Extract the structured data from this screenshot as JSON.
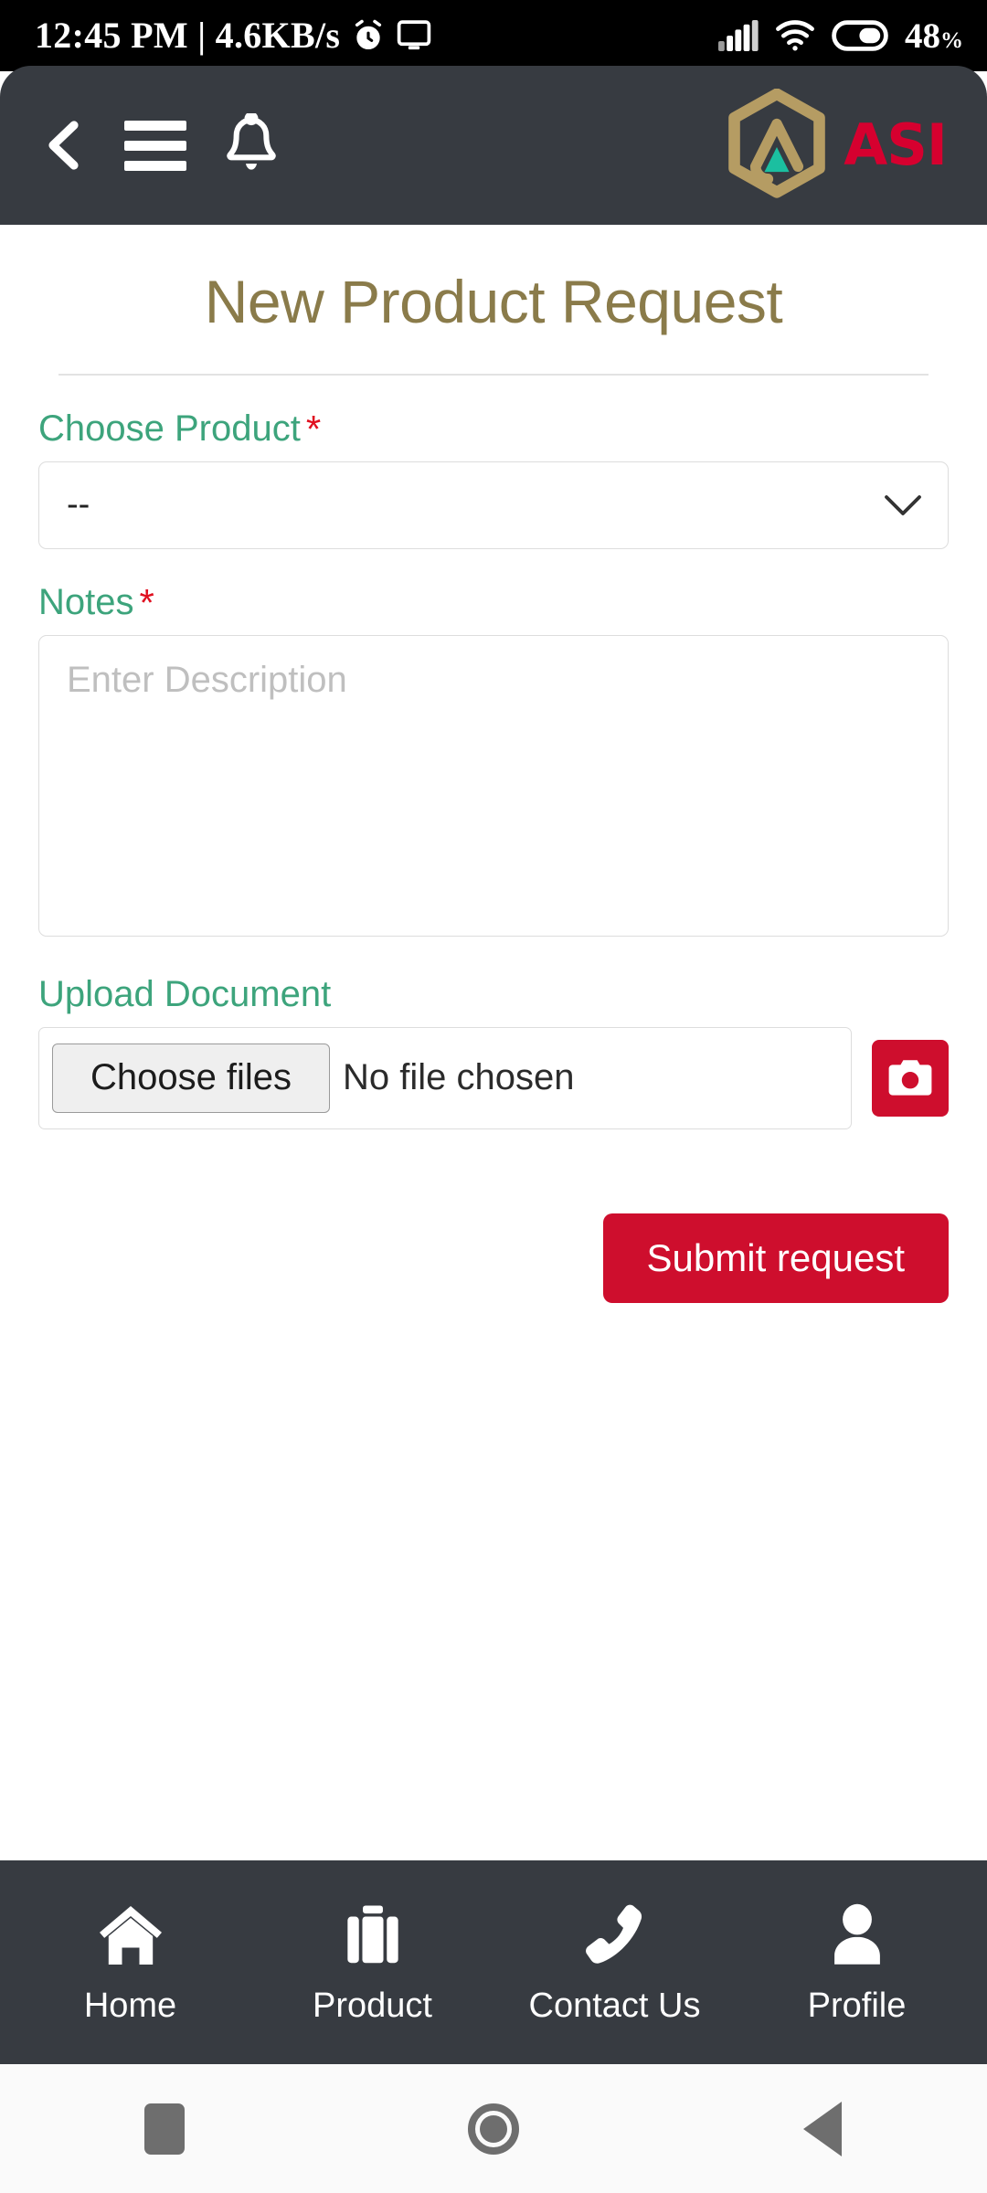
{
  "status_bar": {
    "time": "12:45 PM",
    "separator": "|",
    "network_speed": "4.6KB/s",
    "alarm_icon": "alarm-icon",
    "cast_icon": "cast-screen-icon",
    "signal_icon": "cellular-signal-icon",
    "wifi_icon": "wifi-icon",
    "battery_icon": "battery-icon",
    "battery_percent": "48",
    "battery_unit": "%"
  },
  "header": {
    "back_icon": "back-chevron-icon",
    "menu_icon": "hamburger-menu-icon",
    "bell_icon": "notification-bell-icon",
    "logo_icon": "asi-hexagon-logo-icon",
    "brand": "ASI",
    "brand_color": "#D6002F",
    "logo_hex_color": "#B59C63",
    "logo_accent_color": "#1BBFA0",
    "background_color": "#373B41"
  },
  "page": {
    "title": "New Product Request",
    "title_color": "#8A7B4A"
  },
  "form": {
    "label_color": "#3DA47C",
    "required_mark": "*",
    "required_color": "#E01020",
    "product": {
      "label": "Choose Product",
      "required": true,
      "selected_value": "--",
      "options": [
        "--"
      ],
      "chevron_icon": "chevron-down-icon"
    },
    "notes": {
      "label": "Notes",
      "required": true,
      "value": "",
      "placeholder": "Enter Description"
    },
    "upload": {
      "label": "Upload Document",
      "required": false,
      "choose_button": "Choose files",
      "file_status": "No file chosen",
      "camera_icon": "camera-icon",
      "camera_button_color": "#CE0E2D"
    },
    "submit": {
      "label": "Submit request",
      "color": "#CE0E2D"
    }
  },
  "bottom_nav": {
    "background_color": "#373B41",
    "items": [
      {
        "label": "Home",
        "icon": "home-icon"
      },
      {
        "label": "Product",
        "icon": "briefcase-icon"
      },
      {
        "label": "Contact Us",
        "icon": "phone-icon"
      },
      {
        "label": "Profile",
        "icon": "person-icon"
      }
    ]
  },
  "android_nav": {
    "recents_icon": "recents-square-icon",
    "home_icon": "home-circle-icon",
    "back_icon": "back-triangle-icon"
  }
}
